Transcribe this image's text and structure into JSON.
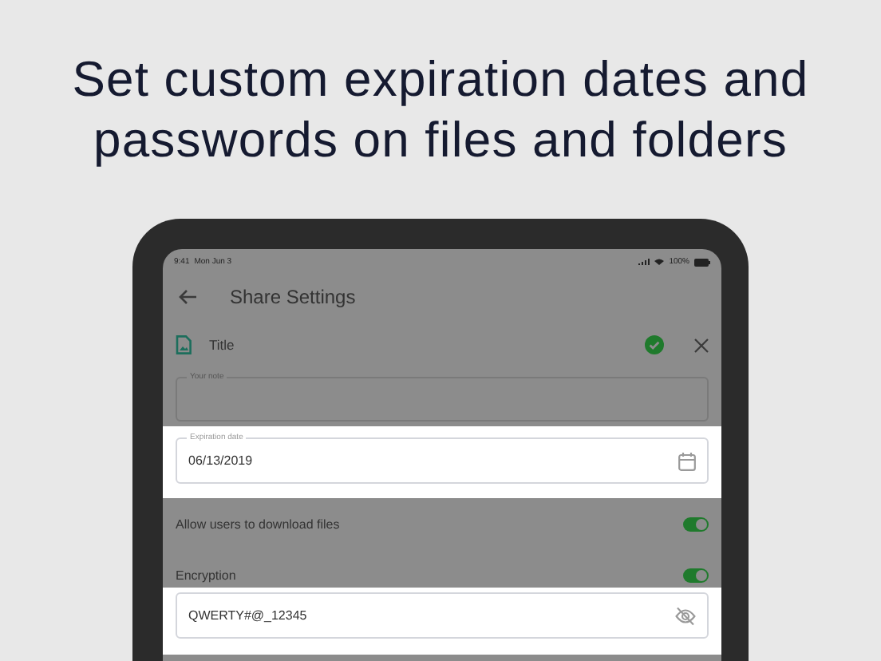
{
  "headline": "Set custom expiration dates and passwords on files and folders",
  "status_bar": {
    "time": "9:41",
    "date": "Mon Jun 3",
    "battery": "100%"
  },
  "header": {
    "title": "Share Settings"
  },
  "file": {
    "title": "Title",
    "confirmed": true
  },
  "note": {
    "label": "Your note"
  },
  "expiration": {
    "label": "Expiration date",
    "value": "06/13/2019"
  },
  "toggles": [
    {
      "label": "Allow users to download files",
      "on": true
    },
    {
      "label": "Encryption",
      "on": true
    }
  ],
  "password": {
    "value": "QWERTY#@_12345"
  }
}
